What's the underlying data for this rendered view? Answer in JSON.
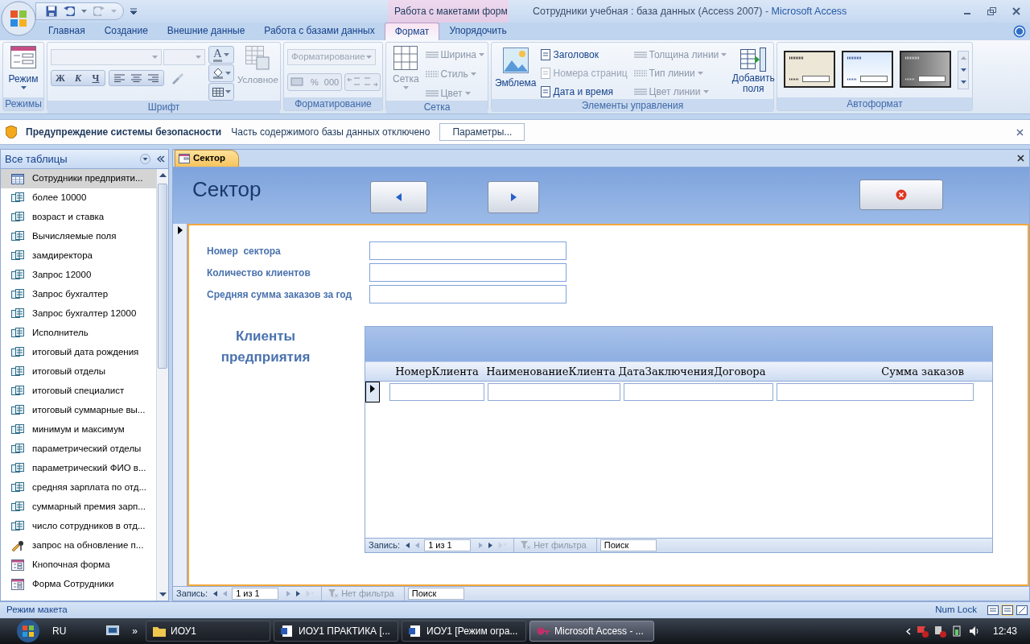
{
  "window": {
    "context_group": "Работа с макетами форм",
    "title": "Сотрудники учебная : база данных (Access 2007)",
    "separator": "-",
    "app": "Microsoft Access"
  },
  "ribbon_tabs": [
    {
      "label": "Главная",
      "selected": false
    },
    {
      "label": "Создание",
      "selected": false
    },
    {
      "label": "Внешние данные",
      "selected": false
    },
    {
      "label": "Работа с базами данных",
      "selected": false
    },
    {
      "label": "Формат",
      "selected": true
    },
    {
      "label": "Упорядочить",
      "selected": false
    }
  ],
  "ribbon": {
    "modes": {
      "button": "Режим",
      "label": "Режимы"
    },
    "font": {
      "label": "Шрифт",
      "bold": "Ж",
      "italic": "К",
      "underline": "Ч",
      "font_color": "A",
      "conditional": "Условное"
    },
    "formatting": {
      "label": "Форматирование",
      "dropdown": "Форматирование",
      "percent": "%",
      "thousands": "000"
    },
    "grid": {
      "label": "Сетка",
      "button": "Сетка",
      "items": [
        {
          "label": "Ширина"
        },
        {
          "label": "Стиль"
        },
        {
          "label": "Цвет"
        }
      ]
    },
    "controls": {
      "label": "Элементы управления",
      "logo": "Эмблема",
      "items": [
        {
          "label": "Заголовок",
          "disabled": false
        },
        {
          "label": "Номера страниц",
          "disabled": true
        },
        {
          "label": "Дата и время",
          "disabled": false
        }
      ],
      "line_items": [
        {
          "label": "Толщина линии"
        },
        {
          "label": "Тип линии"
        },
        {
          "label": "Цвет линии"
        }
      ],
      "add_fields": "Добавить поля"
    },
    "autoformat": {
      "label": "Автоформат"
    }
  },
  "security_bar": {
    "title": "Предупреждение системы безопасности",
    "message": "Часть содержимого базы данных отключено",
    "button": "Параметры..."
  },
  "nav_pane": {
    "title": "Все таблицы",
    "items": [
      {
        "label": "Сотрудники предприяти...",
        "kind": "table",
        "selected": true
      },
      {
        "label": "более 10000",
        "kind": "query",
        "selected": false
      },
      {
        "label": "возраст и ставка",
        "kind": "query",
        "selected": false
      },
      {
        "label": "Вычисляемые поля",
        "kind": "query",
        "selected": false
      },
      {
        "label": "замдиректора",
        "kind": "query",
        "selected": false
      },
      {
        "label": "Запрос 12000",
        "kind": "query",
        "selected": false
      },
      {
        "label": "Запрос бухгалтер",
        "kind": "query",
        "selected": false
      },
      {
        "label": "Запрос бухгалтер 12000",
        "kind": "query",
        "selected": false
      },
      {
        "label": "Исполнитель",
        "kind": "query",
        "selected": false
      },
      {
        "label": "итоговый дата рождения",
        "kind": "query",
        "selected": false
      },
      {
        "label": "итоговый отделы",
        "kind": "query",
        "selected": false
      },
      {
        "label": "итоговый специалист",
        "kind": "query",
        "selected": false
      },
      {
        "label": "итоговый суммарные вы...",
        "kind": "query",
        "selected": false
      },
      {
        "label": "минимум и максимум",
        "kind": "query",
        "selected": false
      },
      {
        "label": "параметрический отделы",
        "kind": "query",
        "selected": false
      },
      {
        "label": "параметрический ФИО в...",
        "kind": "query",
        "selected": false
      },
      {
        "label": "средняя зарплата по отд...",
        "kind": "query",
        "selected": false
      },
      {
        "label": "суммарный премия зарп...",
        "kind": "query",
        "selected": false
      },
      {
        "label": "число сотрудников в отд...",
        "kind": "query",
        "selected": false
      },
      {
        "label": "запрос на обновление п...",
        "kind": "update",
        "selected": false
      },
      {
        "label": "Кнопочная форма",
        "kind": "form",
        "selected": false
      },
      {
        "label": "Форма Сотрудники",
        "kind": "form",
        "selected": false
      }
    ]
  },
  "document": {
    "tab": "Сектор",
    "form_title": "Сектор",
    "fields": [
      {
        "label": "Номер  сектора"
      },
      {
        "label": "Количество клиентов"
      },
      {
        "label": "Средняя сумма заказов за год"
      }
    ],
    "subform": {
      "title": "Клиенты предприятия",
      "columns": [
        "НомерКлиента",
        "НаименованиеКлиента",
        "ДатаЗаключенияДоговора",
        "Сумма заказов"
      ],
      "record_nav": {
        "label": "Запись:",
        "position": "1 из 1",
        "filter": "Нет фильтра",
        "search": "Поиск"
      }
    },
    "record_nav": {
      "label": "Запись:",
      "position": "1 из 1",
      "filter": "Нет фильтра",
      "search": "Поиск"
    }
  },
  "status_bar": {
    "mode": "Режим макета",
    "num_lock": "Num Lock"
  },
  "taskbar": {
    "language": "RU",
    "overflow": "»",
    "tasks": [
      {
        "label": "ИОУ1",
        "kind": "folder",
        "selected": false
      },
      {
        "label": "ИОУ1 ПРАКТИКА [...",
        "kind": "word",
        "selected": false
      },
      {
        "label": "ИОУ1 [Режим огра...",
        "kind": "word",
        "selected": false
      },
      {
        "label": "Microsoft Access - ...",
        "kind": "access",
        "selected": true
      }
    ],
    "clock": "12:43"
  }
}
